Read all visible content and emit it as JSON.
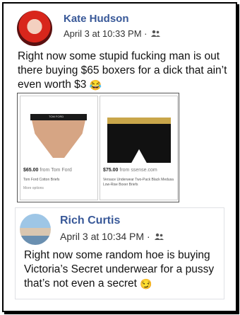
{
  "post1": {
    "author": "Kate Hudson",
    "date": "April 3 at 10:33 PM ·",
    "text": "Right now some stupid fucking man is out there buying $65 boxers for a dick that ain’t even worth $3",
    "emoji": "😂",
    "products": [
      {
        "price": "$65.00",
        "store": "from Tom Ford",
        "name": "Tom Ford Cotton Briefs",
        "more": "More options",
        "brand_mark": "TOM FORD",
        "color": "#d6a584"
      },
      {
        "price": "$75.00",
        "store": "from ssense.com",
        "name": "Versace Underwear Two-Pack Black Medusa Low-Rise Boxer Briefs",
        "more": "",
        "brand_mark": "",
        "color": "#111111"
      }
    ]
  },
  "post2": {
    "author": "Rich Curtis",
    "date": "April 3 at 10:34 PM ·",
    "text": "Right now some random hoe is buying Victoria’s Secret underwear for a pussy that’s not even a secret",
    "emoji": "😏"
  },
  "icons": {
    "audience": "friends-icon"
  },
  "colors": {
    "name": "#385898",
    "text": "#111111"
  }
}
